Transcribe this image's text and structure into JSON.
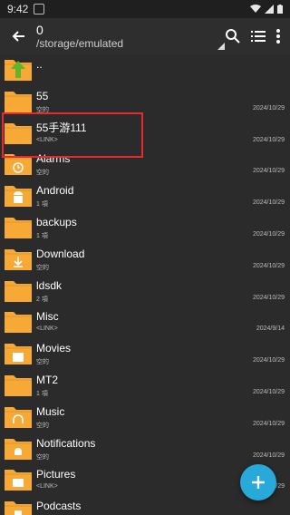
{
  "status": {
    "time": "9:42"
  },
  "toolbar": {
    "title": "0",
    "path": "/storage/emulated"
  },
  "files": [
    {
      "name": "..",
      "sub": "",
      "date": "",
      "icon": "up-arrow-icon"
    },
    {
      "name": "55",
      "sub": "空的",
      "date": "2024/10/29",
      "icon": ""
    },
    {
      "name": "55手游111",
      "sub": "<LINK>",
      "date": "2024/10/29",
      "icon": ""
    },
    {
      "name": "Alarms",
      "sub": "空的",
      "date": "2024/10/29",
      "icon": "alarm-icon"
    },
    {
      "name": "Android",
      "sub": "1 項",
      "date": "2024/10/29",
      "icon": "android-icon"
    },
    {
      "name": "backups",
      "sub": "1 項",
      "date": "2024/10/29",
      "icon": ""
    },
    {
      "name": "Download",
      "sub": "空的",
      "date": "2024/10/29",
      "icon": "download-icon"
    },
    {
      "name": "ldsdk",
      "sub": "2 項",
      "date": "2024/10/29",
      "icon": ""
    },
    {
      "name": "Misc",
      "sub": "<LINK>",
      "date": "2024/9/14",
      "icon": ""
    },
    {
      "name": "Movies",
      "sub": "空的",
      "date": "2024/10/29",
      "icon": "movie-icon"
    },
    {
      "name": "MT2",
      "sub": "1 項",
      "date": "2024/10/29",
      "icon": ""
    },
    {
      "name": "Music",
      "sub": "空的",
      "date": "2024/10/29",
      "icon": "headphones-icon"
    },
    {
      "name": "Notifications",
      "sub": "空的",
      "date": "2024/10/29",
      "icon": "bell-icon"
    },
    {
      "name": "Pictures",
      "sub": "<LINK>",
      "date": "2024/10/29",
      "icon": "picture-icon"
    },
    {
      "name": "Podcasts",
      "sub": "",
      "date": "",
      "icon": "podcast-icon"
    }
  ],
  "colors": {
    "folder": "#f7a935",
    "accent": "#27a9d9",
    "highlight": "#e52b2b"
  }
}
